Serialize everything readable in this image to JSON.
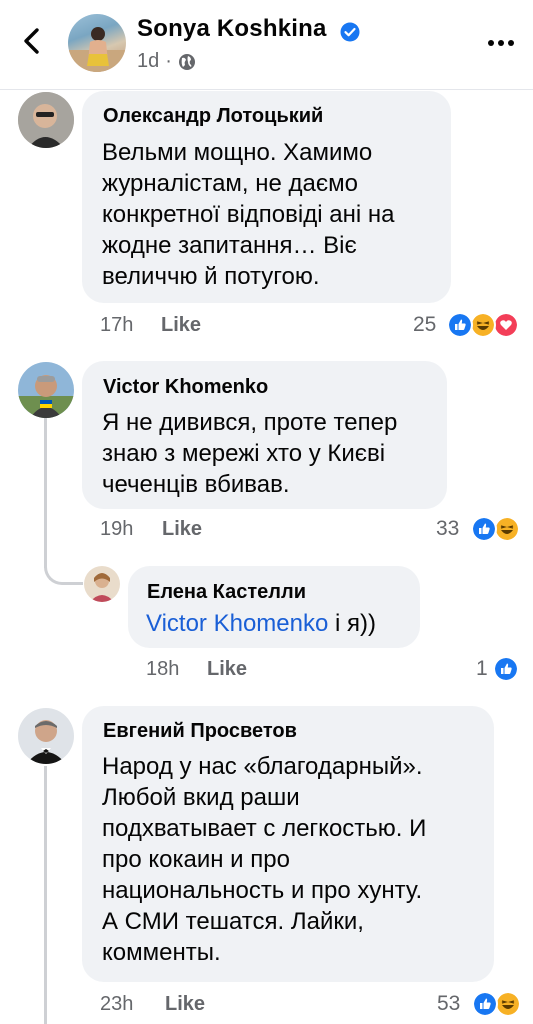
{
  "header": {
    "name": "Sonya Koshkina",
    "time": "1d",
    "dot": "·"
  },
  "comments": [
    {
      "author": "Олександр Лотоцький",
      "lines": [
        "Вельми мощно. Хамимо",
        "журналістам, не даємо",
        "конкретної відповіді ані на",
        "жодне запитання… Віє",
        "величчю й потугою."
      ],
      "time": "17h",
      "like": "Like",
      "reactions_count": "25",
      "reactions": [
        "like",
        "haha",
        "love"
      ]
    },
    {
      "author": "Victor Khomenko",
      "lines": [
        "Я не дивився, проте тепер",
        "знаю з мережі хто у Києві",
        "чеченців вбивав."
      ],
      "time": "19h",
      "like": "Like",
      "reactions_count": "33",
      "reactions": [
        "like",
        "haha"
      ]
    },
    {
      "author": "Елена Кастелли",
      "mention": "Victor Khomenko",
      "rest": " і я))",
      "time": "18h",
      "like": "Like",
      "reactions_count": "1",
      "reactions": [
        "like"
      ]
    },
    {
      "author": "Евгений Просветов",
      "lines": [
        "Народ  у нас «благодарный».",
        "Любой вкид раши",
        "подхватывает с легкостью. И",
        "про кокаин и про",
        "национальность и про хунту.",
        "А СМИ тешатся. Лайки,",
        "комменты."
      ],
      "time": "23h",
      "like": "Like",
      "reactions_count": "53",
      "reactions": [
        "like",
        "haha"
      ]
    }
  ],
  "colors": {
    "bubble": "#f0f2f5",
    "secondary_text": "#65676b",
    "link": "#1a5fd6",
    "like_blue": "#1877f2",
    "love_red": "#f33e58",
    "haha_yellow": "#f7b125"
  },
  "icons": [
    "back-arrow-icon",
    "verified-badge-icon",
    "globe-icon",
    "more-options-icon",
    "like-reaction-icon",
    "haha-reaction-icon",
    "love-reaction-icon"
  ]
}
